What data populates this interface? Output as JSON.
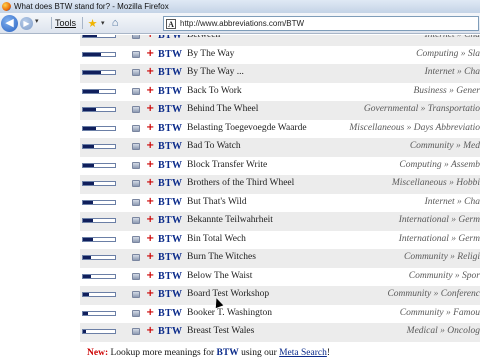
{
  "window": {
    "title": "What does BTW stand for? - Mozilla Firefox"
  },
  "toolbar": {
    "back_glyph": "◀",
    "forward_glyph": "▶",
    "dropdown_glyph": "▾",
    "tools_label": "Tools",
    "url": "http://www.abbreviations.com/BTW",
    "icons": [
      "back-icon",
      "forward-icon",
      "bookmark-star-icon",
      "home-icon"
    ]
  },
  "results": {
    "acronym": "BTW",
    "rows": [
      {
        "meaning": "Between",
        "category": "Internet » Cha",
        "rating": 0.45
      },
      {
        "meaning": "By The Way",
        "category": "Computing » Sla",
        "rating": 0.55
      },
      {
        "meaning": "By The Way ...",
        "category": "Internet » Cha",
        "rating": 0.55
      },
      {
        "meaning": "Back To Work",
        "category": "Business » Gener",
        "rating": 0.5
      },
      {
        "meaning": "Behind The Wheel",
        "category": "Governmental » Transportatio",
        "rating": 0.4
      },
      {
        "meaning": "Belasting Toegevoegde Waarde",
        "category": "Miscellaneous » Days Abbreviatio",
        "rating": 0.4
      },
      {
        "meaning": "Bad To Watch",
        "category": "Community » Med",
        "rating": 0.35
      },
      {
        "meaning": "Block Transfer Write",
        "category": "Computing » Assemb",
        "rating": 0.35
      },
      {
        "meaning": "Brothers of the Third Wheel",
        "category": "Miscellaneous » Hobbi",
        "rating": 0.35
      },
      {
        "meaning": "But That's Wild",
        "category": "Internet » Cha",
        "rating": 0.3
      },
      {
        "meaning": "Bekannte Teilwahrheit",
        "category": "International » Germ",
        "rating": 0.3
      },
      {
        "meaning": "Bin Total Wech",
        "category": "International » Germ",
        "rating": 0.3
      },
      {
        "meaning": "Burn The Witches",
        "category": "Community » Religi",
        "rating": 0.25
      },
      {
        "meaning": "Below The Waist",
        "category": "Community » Spor",
        "rating": 0.25
      },
      {
        "meaning": "Board Test Workshop",
        "category": "Community » Conferenc",
        "rating": 0.2
      },
      {
        "meaning": "Booker T. Washington",
        "category": "Community » Famou",
        "rating": 0.15
      },
      {
        "meaning": "Breast Test Wales",
        "category": "Medical » Oncolog",
        "rating": 0.1
      }
    ]
  },
  "footer": {
    "new_label": "New:",
    "text_before": "Lookup more meanings for",
    "keyword": "BTW",
    "text_middle": "using our",
    "link_text": "Meta Search",
    "text_after": "!"
  },
  "colors": {
    "acronym": "#0a2a8a",
    "plus": "#cc0000",
    "rating_fill": "#101f5c",
    "row_stripe": "#ececec"
  }
}
